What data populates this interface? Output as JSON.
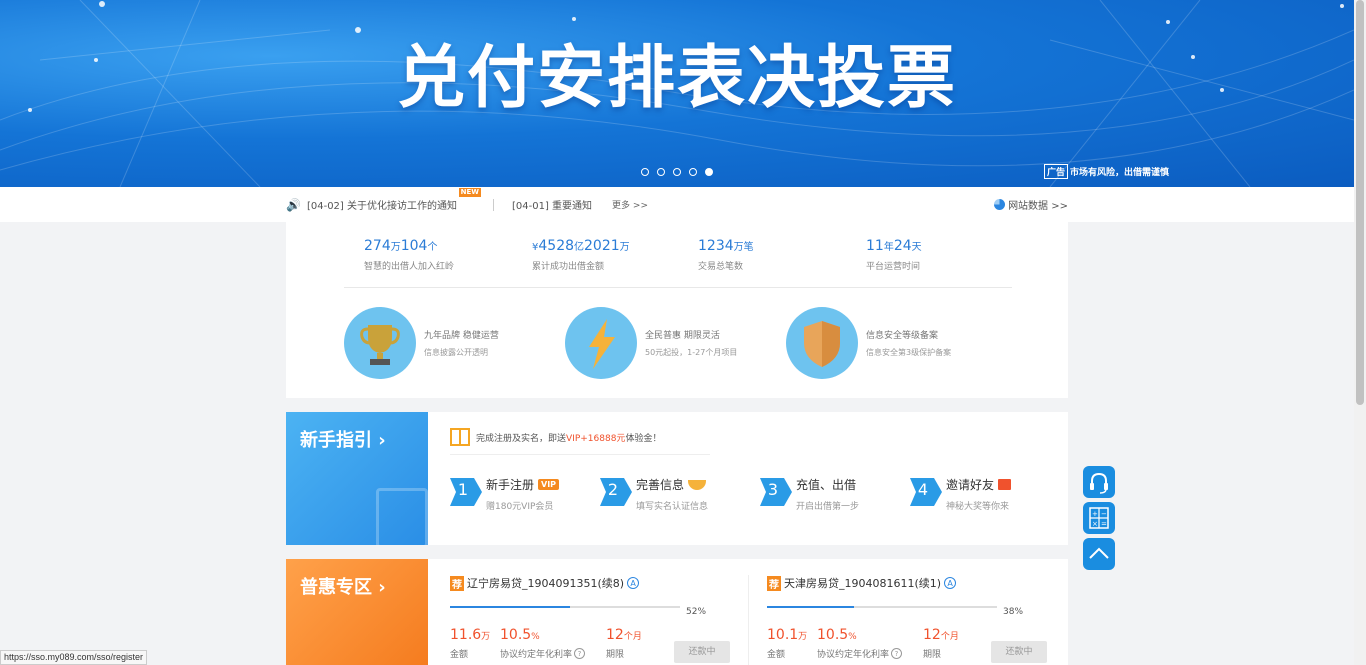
{
  "banner": {
    "title": "兑付安排表决投票",
    "dots": [
      false,
      false,
      false,
      false,
      true
    ],
    "ad_tag": "广告",
    "ad_text": "市场有风险，出借需谨慎"
  },
  "notice": {
    "item1": "[04-02] 关于优化接访工作的通知",
    "new_badge": "NEW",
    "item2": "[04-01] 重要通知",
    "more": "更多 >>",
    "stats_link": "网站数据 >>"
  },
  "stats": {
    "s1_value_a": "274",
    "s1_unit_a": "万",
    "s1_value_b": "104",
    "s1_unit_b": "个",
    "s1_label": "智慧的出借人加入红岭",
    "s2_prefix": "¥",
    "s2_value_a": "4528",
    "s2_unit_a": "亿",
    "s2_value_b": "2021",
    "s2_unit_b": "万",
    "s2_label": "累计成功出借金额",
    "s3_value": "1234",
    "s3_unit": "万笔",
    "s3_label": "交易总笔数",
    "s4_value_a": "11",
    "s4_unit_a": "年",
    "s4_value_b": "24",
    "s4_unit_b": "天",
    "s4_label": "平台运营时间"
  },
  "features": [
    {
      "title": "九年品牌 稳健运营",
      "sub": "信息披露公开透明",
      "icon": "trophy-icon"
    },
    {
      "title": "全民普惠 期限灵活",
      "sub": "50元起投，1-27个月项目",
      "icon": "lightning-icon"
    },
    {
      "title": "信息安全等级备案",
      "sub": "信息安全第3级保护备案",
      "icon": "shield-icon"
    }
  ],
  "guide": {
    "title": "新手指引",
    "arrow": "›",
    "promo_prefix": "完成注册及实名，即送",
    "promo_highlight": "VIP+16888元",
    "promo_suffix": "体验金！",
    "steps": [
      {
        "num": "1",
        "title": "新手注册",
        "badge": "VIP",
        "sub": "赠180元VIP会员"
      },
      {
        "num": "2",
        "title": "完善信息",
        "sub": "填写实名认证信息"
      },
      {
        "num": "3",
        "title": "充值、出借",
        "sub": "开启出借第一步"
      },
      {
        "num": "4",
        "title": "邀请好友",
        "sub": "神秘大奖等你来"
      }
    ]
  },
  "benefit": {
    "title": "普惠专区",
    "arrow": "›",
    "products": [
      {
        "rec": "荐",
        "name": "辽宁房易贷_1904091351(续8)",
        "a": "A",
        "progress": 52,
        "progress_label": "52%",
        "amount": "11.6",
        "amount_unit": "万",
        "amount_label": "金额",
        "rate": "10.5",
        "rate_unit": "%",
        "rate_label": "协议约定年化利率",
        "q": "?",
        "term": "12",
        "term_unit": "个月",
        "term_label": "期限",
        "button": "还款中"
      },
      {
        "rec": "荐",
        "name": "天津房易贷_1904081611(续1)",
        "a": "A",
        "progress": 38,
        "progress_label": "38%",
        "amount": "10.1",
        "amount_unit": "万",
        "amount_label": "金额",
        "rate": "10.5",
        "rate_unit": "%",
        "rate_label": "协议约定年化利率",
        "q": "?",
        "term": "12",
        "term_unit": "个月",
        "term_label": "期限",
        "button": "还款中"
      }
    ]
  },
  "float_tools": [
    "headset-icon",
    "calculator-icon",
    "back-to-top-icon"
  ],
  "status_url": "https://sso.my089.com/sso/register",
  "colors": {
    "primary": "#2b86e0",
    "accent": "#f58a1f",
    "highlight": "#f0522d"
  }
}
